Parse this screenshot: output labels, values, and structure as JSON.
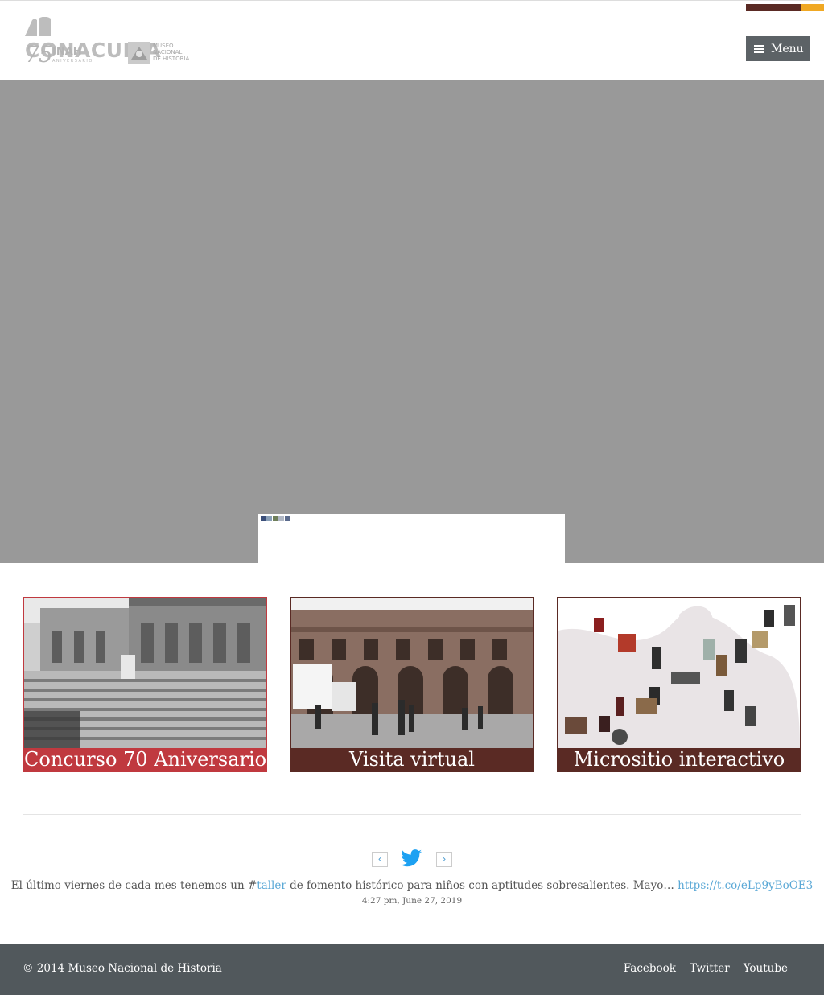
{
  "header": {
    "logo": {
      "brand": "CONACULTA",
      "anniversary_number": "75",
      "inah": "INAH",
      "anniversary_word": "ANIVERSARIO",
      "museum_lines": [
        "MUSEO",
        "NACIONAL",
        "DE HISTORIA"
      ]
    },
    "accent_colors": [
      "#5a2a24",
      "#f0a823"
    ],
    "menu_label": "Menu"
  },
  "cards": [
    {
      "caption": "Concurso 70 Aniversario",
      "image": "historic-crowd-photo"
    },
    {
      "caption": "Visita virtual",
      "image": "castle-courtyard-photo"
    },
    {
      "caption": "Micrositio interactivo",
      "image": "interactive-map-illustration"
    }
  ],
  "twitter": {
    "prev": "‹",
    "next": "›",
    "tweet": {
      "before_tag": "El último viernes de cada mes tenemos un #",
      "tag": "taller",
      "after_tag": " de fomento histórico para niños con aptitudes sobresalientes. Mayo… ",
      "link": "https://t.co/eLp9yBoOE3"
    },
    "time": "4:27 pm, June 27, 2019"
  },
  "footer": {
    "copyright": "© 2014 Museo Nacional de Historia",
    "links": [
      "Facebook",
      "Twitter",
      "Youtube"
    ]
  },
  "colors": {
    "maroon": "#5a2a24",
    "red": "#c0393f",
    "orange": "#f0a823",
    "footer": "#51585c",
    "link": "#5aa8d6",
    "hero": "#999999"
  }
}
